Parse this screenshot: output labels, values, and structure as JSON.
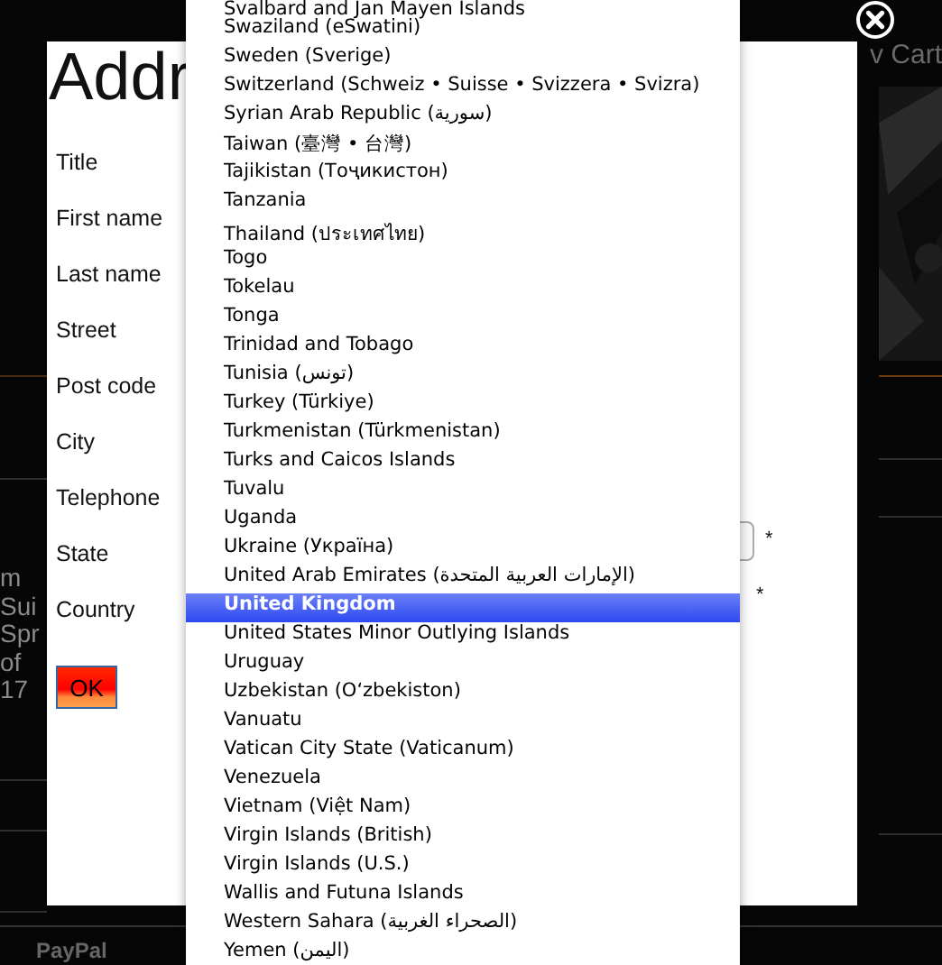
{
  "background": {
    "cart_link": "v Cart",
    "side_text": [
      "m",
      "Sui",
      "Spr",
      "of",
      "17"
    ],
    "footer_text": "PayPal"
  },
  "dialog": {
    "title": "Addr",
    "fields": [
      {
        "label": "Title"
      },
      {
        "label": "First name"
      },
      {
        "label": "Last name"
      },
      {
        "label": "Street"
      },
      {
        "label": "Post code"
      },
      {
        "label": "City"
      },
      {
        "label": "Telephone"
      },
      {
        "label": "State",
        "box": true,
        "required_mark": "*"
      },
      {
        "label": "Country",
        "required_mark": "*"
      }
    ],
    "ok_button": "OK"
  },
  "country_list": {
    "items": [
      {
        "label": "Svalbard and Jan Mayen Islands",
        "selected": false
      },
      {
        "label": "Swaziland (eSwatini)",
        "selected": false
      },
      {
        "label": "Sweden (Sverige)",
        "selected": false
      },
      {
        "label": "Switzerland (Schweiz • Suisse • Svizzera • Svizra)",
        "selected": false
      },
      {
        "label": "Syrian Arab Republic (سورية)",
        "selected": false
      },
      {
        "label": "Taiwan (臺灣 • 台灣)",
        "selected": false
      },
      {
        "label": "Tajikistan (Тоҷикистон)",
        "selected": false
      },
      {
        "label": "Tanzania",
        "selected": false
      },
      {
        "label": "Thailand (ประเทศไทย)",
        "selected": false
      },
      {
        "label": "Togo",
        "selected": false
      },
      {
        "label": "Tokelau",
        "selected": false
      },
      {
        "label": "Tonga",
        "selected": false
      },
      {
        "label": "Trinidad and Tobago",
        "selected": false
      },
      {
        "label": "Tunisia (تونس)",
        "selected": false
      },
      {
        "label": "Turkey (Türkiye)",
        "selected": false
      },
      {
        "label": "Turkmenistan (Türkmenistan)",
        "selected": false
      },
      {
        "label": "Turks and Caicos Islands",
        "selected": false
      },
      {
        "label": "Tuvalu",
        "selected": false
      },
      {
        "label": "Uganda",
        "selected": false
      },
      {
        "label": "Ukraine (Україна)",
        "selected": false
      },
      {
        "label": "United Arab Emirates (الإمارات العربية المتحدة)",
        "selected": false
      },
      {
        "label": "United Kingdom",
        "selected": true
      },
      {
        "label": "United States Minor Outlying Islands",
        "selected": false
      },
      {
        "label": "Uruguay",
        "selected": false
      },
      {
        "label": "Uzbekistan (O‘zbekiston)",
        "selected": false
      },
      {
        "label": "Vanuatu",
        "selected": false
      },
      {
        "label": "Vatican City State (Vaticanum)",
        "selected": false
      },
      {
        "label": "Venezuela",
        "selected": false
      },
      {
        "label": "Vietnam (Việt Nam)",
        "selected": false
      },
      {
        "label": "Virgin Islands (British)",
        "selected": false
      },
      {
        "label": "Virgin Islands (U.S.)",
        "selected": false
      },
      {
        "label": "Wallis and Futuna Islands",
        "selected": false
      },
      {
        "label": "Western Sahara (الصحراء الغربية)",
        "selected": false
      },
      {
        "label": "Yemen (اليمن)",
        "selected": false
      }
    ]
  }
}
